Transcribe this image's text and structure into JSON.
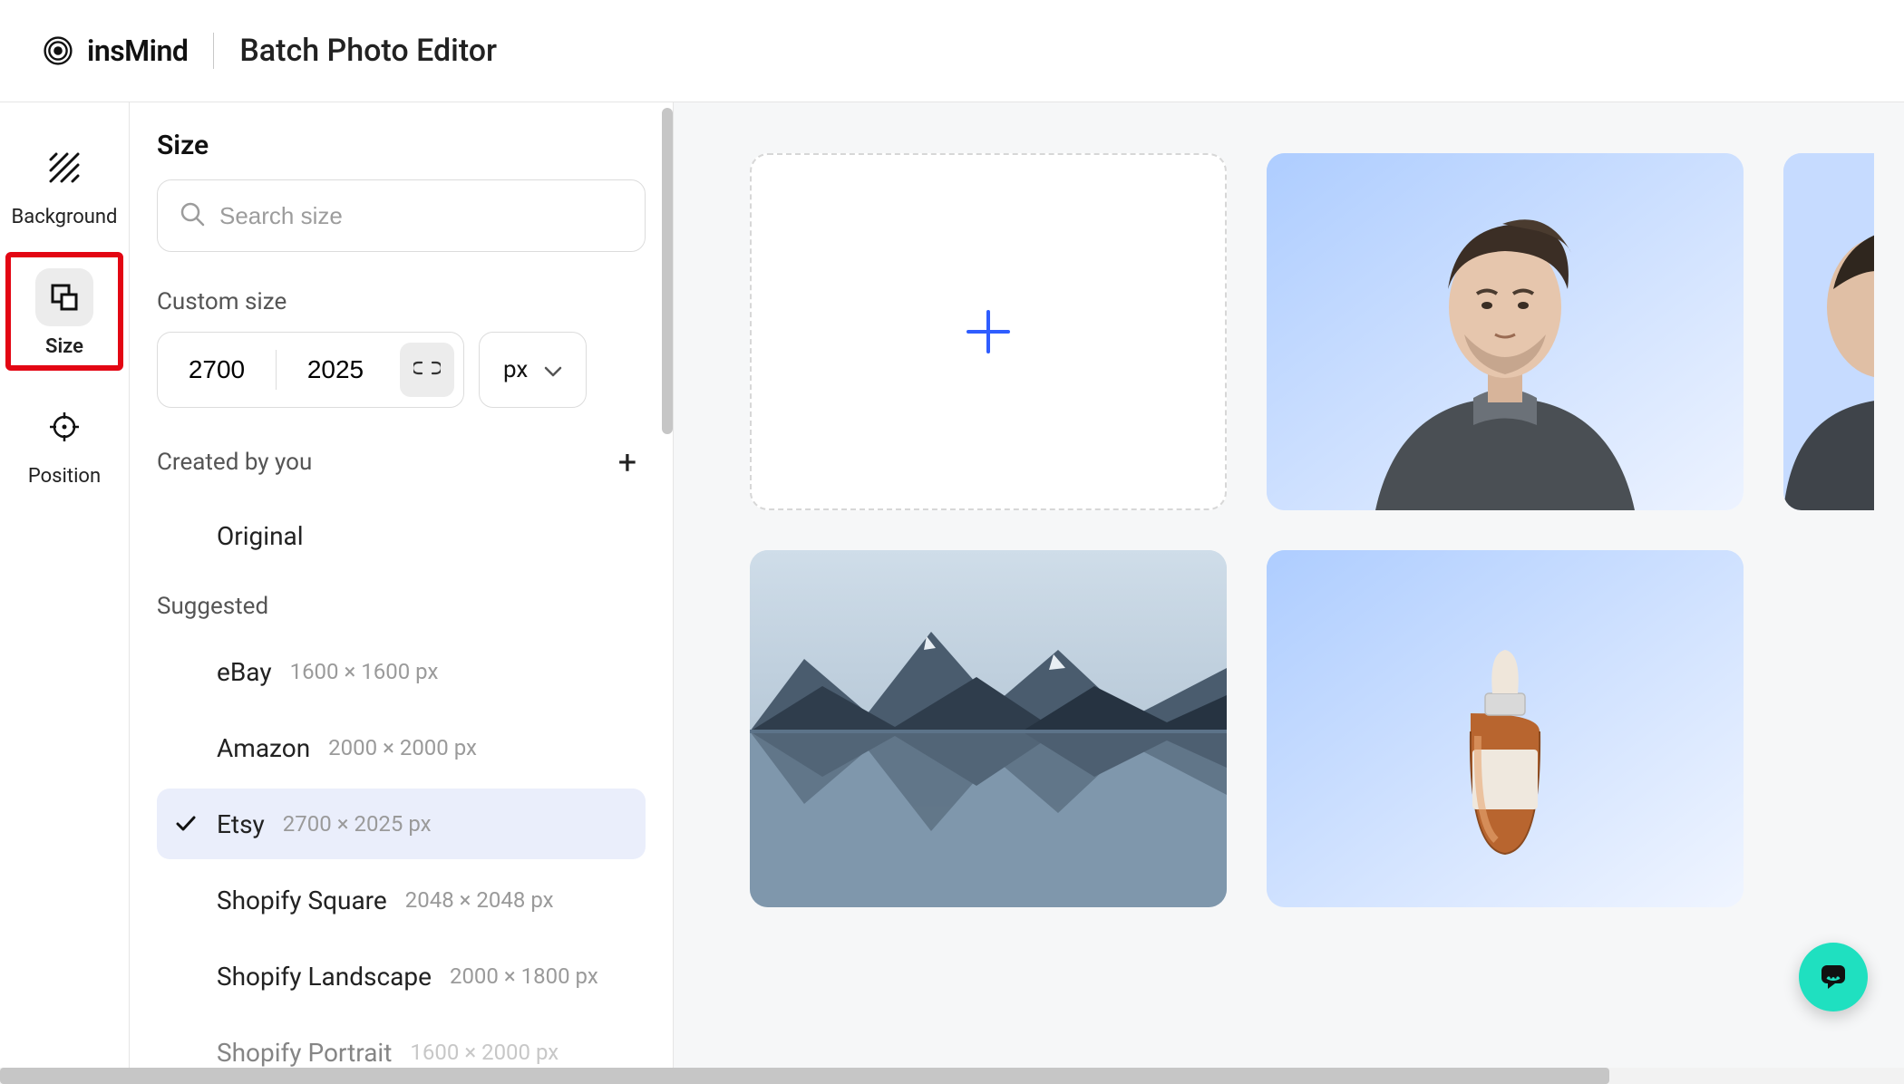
{
  "header": {
    "brand": "insMind",
    "title": "Batch Photo Editor"
  },
  "nav": {
    "items": [
      {
        "label": "Background"
      },
      {
        "label": "Size"
      },
      {
        "label": "Position"
      }
    ],
    "active_index": 1
  },
  "panel": {
    "title": "Size",
    "search_placeholder": "Search size",
    "custom": {
      "label": "Custom size",
      "width": "2700",
      "height": "2025",
      "unit": "px"
    },
    "created": {
      "label": "Created by you",
      "items": [
        {
          "name": "Original",
          "dims": ""
        }
      ]
    },
    "suggested": {
      "label": "Suggested",
      "items": [
        {
          "name": "eBay",
          "dims": "1600 × 1600 px",
          "selected": false
        },
        {
          "name": "Amazon",
          "dims": "2000 × 2000 px",
          "selected": false
        },
        {
          "name": "Etsy",
          "dims": "2700 × 2025 px",
          "selected": true
        },
        {
          "name": "Shopify Square",
          "dims": "2048 × 2048 px",
          "selected": false
        },
        {
          "name": "Shopify Landscape",
          "dims": "2000 × 1800 px",
          "selected": false
        },
        {
          "name": "Shopify Portrait",
          "dims": "1600 × 2000 px",
          "selected": false
        }
      ]
    }
  },
  "canvas": {
    "tiles": [
      {
        "kind": "add"
      },
      {
        "kind": "photo-portrait-man"
      },
      {
        "kind": "photo-portrait-partial"
      },
      {
        "kind": "photo-landscape-mountain"
      },
      {
        "kind": "photo-product-dropper"
      }
    ]
  }
}
